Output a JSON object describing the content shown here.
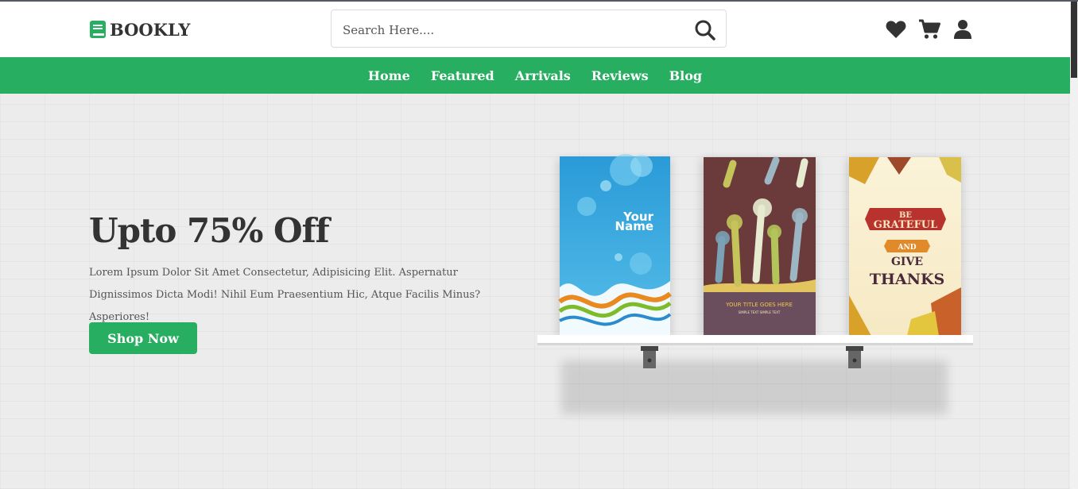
{
  "header": {
    "logo_text": "BOOKLY",
    "search_placeholder": "Search Here....",
    "icons": [
      "search-icon",
      "heart-icon",
      "cart-icon",
      "user-icon"
    ]
  },
  "nav": {
    "items": [
      "Home",
      "Featured",
      "Arrivals",
      "Reviews",
      "Blog"
    ]
  },
  "hero": {
    "title": "Upto 75% Off",
    "text": "Lorem Ipsum Dolor Sit Amet Consectetur, Adipisicing Elit. Aspernatur Dignissimos Dicta Modi! Nihil Eum Praesentium Hic, Atque Facilis Minus? Asperiores!",
    "button": "Shop Now"
  },
  "books": {
    "book1": {
      "line1": "Your",
      "line2": "Name"
    },
    "book2": {
      "title": "YOUR TITLE GOES HERE",
      "subtitle": "SIMPLE TEXT SIMPLE TEXT"
    },
    "book3": {
      "line1": "BE",
      "line2": "GRATEFUL",
      "line3": "AND",
      "line4": "GIVE",
      "line5": "THANKS"
    }
  },
  "colors": {
    "brand_green": "#27ae60",
    "text_dark": "#333333",
    "hero_bg": "#ececec"
  }
}
